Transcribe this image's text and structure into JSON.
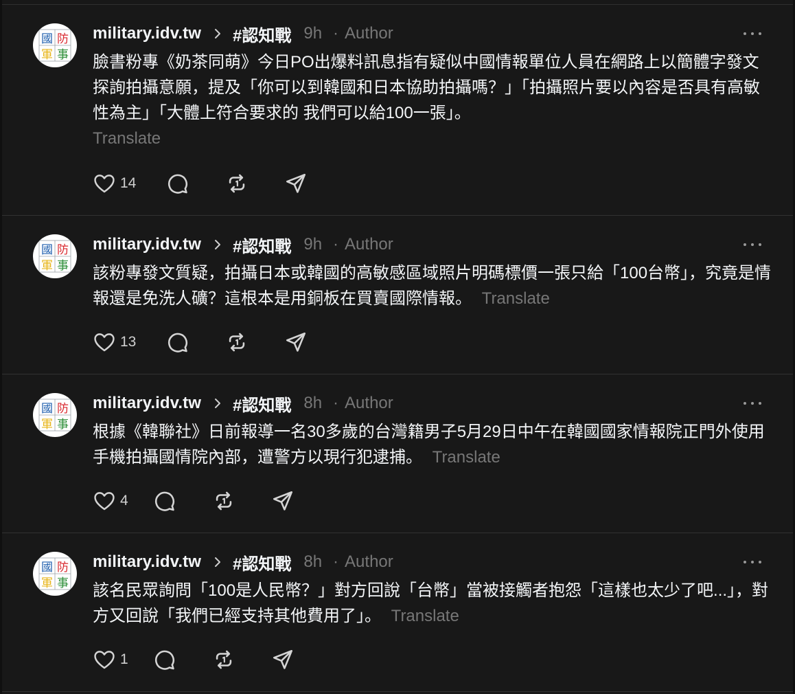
{
  "feed": {
    "posts": [
      {
        "username": "military.idv.tw",
        "tag": "#認知戰",
        "time": "9h",
        "separator": "·",
        "author_label": "Author",
        "text": "臉書粉專《奶茶同萌》今日PO出爆料訊息指有疑似中國情報單位人員在網路上以簡體字發文探詢拍攝意願，提及「你可以到韓國和日本協助拍攝嗎？」「拍攝照片要以內容是否具有高敏性為主」「大體上符合要求的 我們可以給100一張」。",
        "translate_label": "Translate",
        "likes": "14"
      },
      {
        "username": "military.idv.tw",
        "tag": "#認知戰",
        "time": "9h",
        "separator": "·",
        "author_label": "Author",
        "text": "該粉專發文質疑，拍攝日本或韓國的高敏感區域照片明碼標價一張只給「100台幣」，究竟是情報還是免洗人礦？這根本是用銅板在買賣國際情報。",
        "translate_label": "Translate",
        "likes": "13"
      },
      {
        "username": "military.idv.tw",
        "tag": "#認知戰",
        "time": "8h",
        "separator": "·",
        "author_label": "Author",
        "text": "根據《韓聯社》日前報導一名30多歲的台灣籍男子5月29日中午在韓國國家情報院正門外使用手機拍攝國情院內部，遭警方以現行犯逮捕。",
        "translate_label": "Translate",
        "likes": "4"
      },
      {
        "username": "military.idv.tw",
        "tag": "#認知戰",
        "time": "8h",
        "separator": "·",
        "author_label": "Author",
        "text": "該名民眾詢問「100是人民幣？」對方回說「台幣」當被接觸者抱怨「這樣也太少了吧...」，對方又回說「我們已經支持其他費用了」。",
        "translate_label": "Translate",
        "likes": "1"
      }
    ]
  },
  "avatar": {
    "chars": [
      "國",
      "防",
      "軍",
      "事"
    ],
    "colors": [
      "#1f5fae",
      "#d8262c",
      "#e7b51a",
      "#2f8f3a"
    ]
  },
  "icons": {
    "header": [
      "chevron-right-icon",
      "more-icon"
    ],
    "actions": [
      "heart-icon",
      "comment-icon",
      "repost-icon",
      "share-icon"
    ]
  },
  "colors": {
    "background": "#181818",
    "text": "#f3f5f7",
    "secondary": "#777777",
    "divider": "#323232"
  }
}
